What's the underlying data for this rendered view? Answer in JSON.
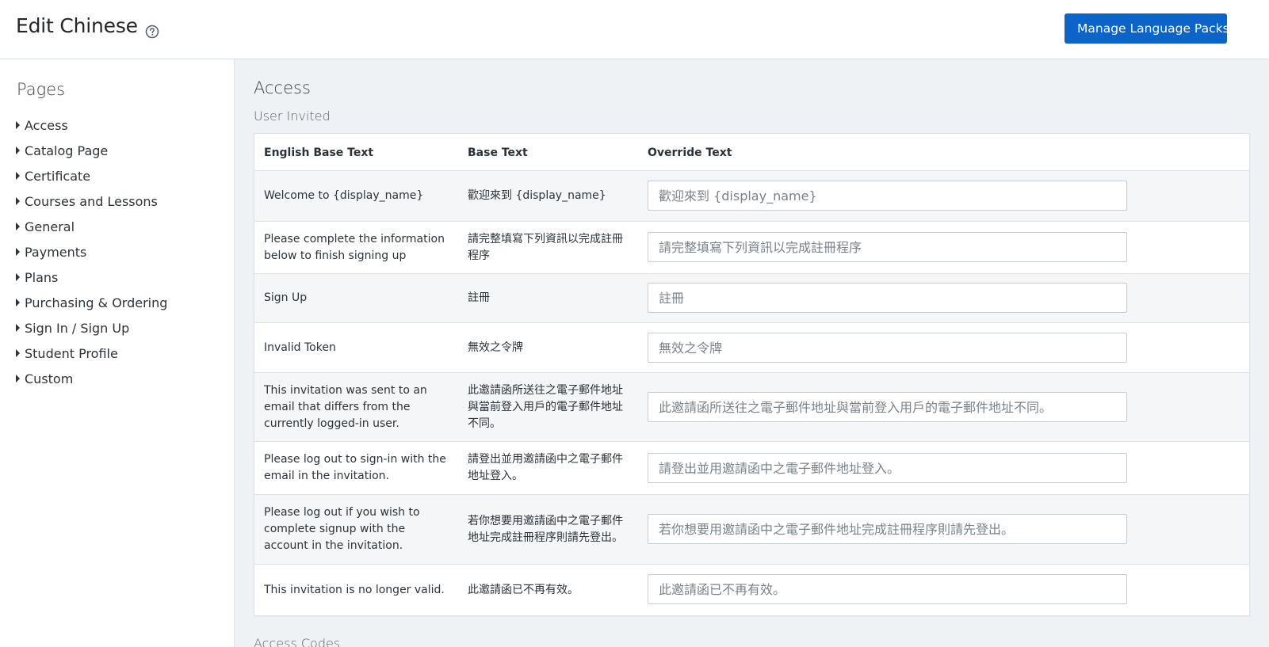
{
  "header": {
    "title": "Edit Chinese",
    "manage_button_label": "Manage Language Packs"
  },
  "sidebar": {
    "title": "Pages",
    "items": [
      {
        "label": "Access"
      },
      {
        "label": "Catalog Page"
      },
      {
        "label": "Certificate"
      },
      {
        "label": "Courses and Lessons"
      },
      {
        "label": "General"
      },
      {
        "label": "Payments"
      },
      {
        "label": "Plans"
      },
      {
        "label": "Purchasing & Ordering"
      },
      {
        "label": "Sign In / Sign Up"
      },
      {
        "label": "Student Profile"
      },
      {
        "label": "Custom"
      }
    ]
  },
  "main": {
    "section_title": "Access",
    "subsection_title": "User Invited",
    "next_section_title": "Access Codes",
    "columns": {
      "english": "English Base Text",
      "base": "Base Text",
      "override": "Override Text"
    },
    "rows": [
      {
        "english": "Welcome to {display_name}",
        "base": "歡迎來到 {display_name}",
        "placeholder": "歡迎來到 {display_name}"
      },
      {
        "english": "Please complete the information below to finish signing up",
        "base": "請完整填寫下列資訊以完成註冊程序",
        "placeholder": "請完整填寫下列資訊以完成註冊程序"
      },
      {
        "english": "Sign Up",
        "base": "註冊",
        "placeholder": "註冊"
      },
      {
        "english": "Invalid Token",
        "base": "無效之令牌",
        "placeholder": "無效之令牌"
      },
      {
        "english": "This invitation was sent to an email that differs from the currently logged-in user.",
        "base": "此邀請函所送往之電子郵件地址與當前登入用戶的電子郵件地址不同。",
        "placeholder": "此邀請函所送往之電子郵件地址與當前登入用戶的電子郵件地址不同。"
      },
      {
        "english": "Please log out to sign-in with the email in the invitation.",
        "base": "請登出並用邀請函中之電子郵件地址登入。",
        "placeholder": "請登出並用邀請函中之電子郵件地址登入。"
      },
      {
        "english": "Please log out if you wish to complete signup with the account in the invitation.",
        "base": "若你想要用邀請函中之電子郵件地址完成註冊程序則請先登出。",
        "placeholder": "若你想要用邀請函中之電子郵件地址完成註冊程序則請先登出。"
      },
      {
        "english": "This invitation is no longer valid.",
        "base": "此邀請函已不再有效。",
        "placeholder": "此邀請函已不再有效。"
      }
    ]
  },
  "colors": {
    "accent": "#0a64c9",
    "main_background": "#eef2f5",
    "row_alt": "#f4f6f8",
    "border": "#dbe1e6"
  },
  "icons": {
    "help": "question-circle-icon",
    "dropdown": "caret-down-icon",
    "expand": "caret-right-icon"
  }
}
